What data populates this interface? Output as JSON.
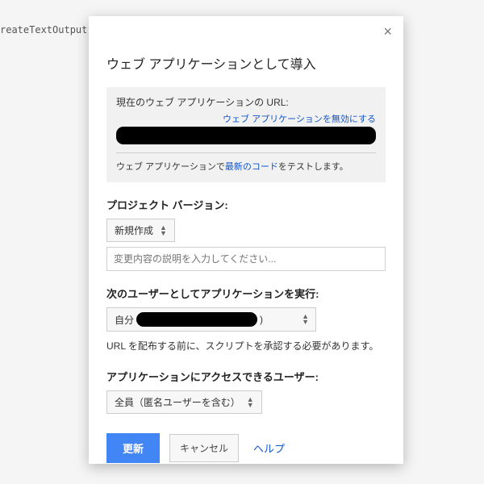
{
  "background": {
    "code_fragment": "reateTextOutput"
  },
  "dialog": {
    "title": "ウェブ アプリケーションとして導入",
    "close_symbol": "×",
    "url_section": {
      "label": "現在のウェブ アプリケーションの URL:",
      "disable_link": "ウェブ アプリケーションを無効にする",
      "test_prefix": "ウェブ アプリケーションで",
      "test_link": "最新のコード",
      "test_suffix": "をテストします。"
    },
    "version": {
      "label": "プロジェクト バージョン:",
      "selected": "新規作成",
      "description_placeholder": "変更内容の説明を入力してください..."
    },
    "run_as": {
      "label": "次のユーザーとしてアプリケーションを実行:",
      "selected_prefix": "自分",
      "selected_suffix": ")",
      "note": "URL を配布する前に、スクリプトを承認する必要があります。"
    },
    "access": {
      "label": "アプリケーションにアクセスできるユーザー:",
      "selected": "全員（匿名ユーザーを含む）"
    },
    "buttons": {
      "update": "更新",
      "cancel": "キャンセル",
      "help": "ヘルプ"
    }
  }
}
